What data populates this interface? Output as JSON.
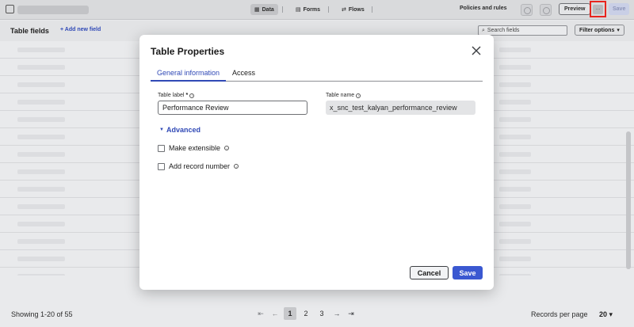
{
  "topbar": {
    "tabs": [
      {
        "label": "Data",
        "icon": "table-icon",
        "active": true
      },
      {
        "label": "Forms",
        "icon": "form-icon",
        "active": false
      },
      {
        "label": "Flows",
        "icon": "flow-icon",
        "active": false
      }
    ],
    "policies_label": "Policies and rules",
    "preview_label": "Preview",
    "more_label": "...",
    "save_label": "Save"
  },
  "subheader": {
    "title": "Table fields",
    "add_field_label": "+ Add new field",
    "search_placeholder": "Search fields",
    "filter_label": "Filter options"
  },
  "footer": {
    "showing": "Showing 1-20 of 55",
    "pages": [
      "1",
      "2",
      "3"
    ],
    "current_page": "1",
    "records_per_page_label": "Records per page",
    "records_per_page_value": "20"
  },
  "modal": {
    "title": "Table Properties",
    "tabs": [
      {
        "label": "General information",
        "active": true
      },
      {
        "label": "Access",
        "active": false
      }
    ],
    "table_label": {
      "label": "Table label",
      "required_mark": "*",
      "value": "Performance Review"
    },
    "table_name": {
      "label": "Table name",
      "value": "x_snc_test_kalyan_performance_review"
    },
    "advanced_label": "Advanced",
    "checkboxes": [
      {
        "label": "Make extensible",
        "checked": false
      },
      {
        "label": "Add record number",
        "checked": false
      }
    ],
    "cancel_label": "Cancel",
    "save_label": "Save"
  },
  "colors": {
    "accent": "#3049b6",
    "primary_button": "#3a58d1",
    "highlight_box": "#e8261f"
  }
}
